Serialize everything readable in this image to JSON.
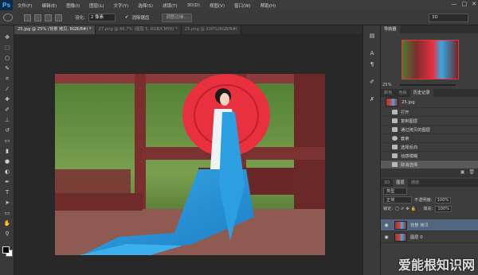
{
  "app": {
    "logo": "Ps"
  },
  "menu": [
    "文件(F)",
    "编辑(E)",
    "图像(I)",
    "图层(L)",
    "文字(Y)",
    "选择(S)",
    "滤镜(T)",
    "3D(D)",
    "视图(V)",
    "窗口(W)",
    "帮助(H)"
  ],
  "window_controls": {
    "minimize": "—",
    "maximize": "□",
    "close": "✕"
  },
  "options": {
    "feather_label": "羽化:",
    "feather_value": "2 像素",
    "antialias_label": "消除锯齿",
    "refine_edge_label": "调整边缘...",
    "workspace": "3D"
  },
  "tabs": [
    {
      "label": "25.jpg @ 25% (背景 拷贝, RGB/8#) *",
      "active": true
    },
    {
      "label": "27.png @ 66.7% (图层 5, RGB/CMYK) *",
      "active": false
    },
    {
      "label": "25.png @ 100%(RGB/8#)",
      "active": false
    }
  ],
  "navigator": {
    "title": "导航器",
    "zoom": "25%"
  },
  "history": {
    "tabs": [
      "颜色",
      "色板",
      "历史记录"
    ],
    "snapshot": "25.jpg",
    "items": [
      "打开",
      "复制图层",
      "通过拷贝的图层",
      "套索",
      "选择反向",
      "动感模糊",
      "取消选择"
    ]
  },
  "layers": {
    "tabs": [
      "3D",
      "图层",
      "通道"
    ],
    "filter": "类型",
    "blend_mode": "正常",
    "opacity_label": "不透明度:",
    "opacity_value": "100%",
    "lock_label": "锁定:",
    "fill_label": "填充:",
    "fill_value": "100%",
    "items": [
      {
        "name": "背景 拷贝",
        "selected": true
      },
      {
        "name": "图层 0",
        "selected": false
      }
    ]
  },
  "watermark": "爱能根知识网",
  "colors": {
    "accent": "#31a8ff",
    "selected_layer": "#526680"
  }
}
